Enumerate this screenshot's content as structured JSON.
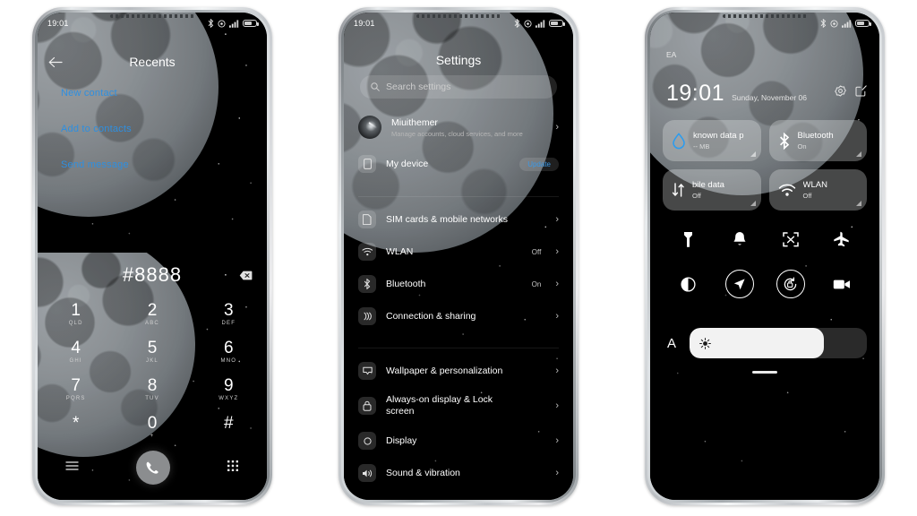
{
  "status_bar": {
    "time": "19:01",
    "icons": [
      "bluetooth-icon",
      "alarm-icon",
      "signal-icon",
      "battery-icon"
    ]
  },
  "phone1": {
    "name": "dialer-recents-screen",
    "appbar": {
      "back_icon": "back-arrow-icon",
      "title": "Recents"
    },
    "links": [
      {
        "label": "New contact"
      },
      {
        "label": "Add to contacts"
      },
      {
        "label": "Send message"
      }
    ],
    "link_color": "#2e8fe0",
    "dialpad": {
      "number": "#8888",
      "delete_icon": "backspace-icon",
      "keys": [
        {
          "digit": "1",
          "sub": "QLD"
        },
        {
          "digit": "2",
          "sub": "ABC"
        },
        {
          "digit": "3",
          "sub": "DEF"
        },
        {
          "digit": "4",
          "sub": "GHI"
        },
        {
          "digit": "5",
          "sub": "JKL"
        },
        {
          "digit": "6",
          "sub": "MNO"
        },
        {
          "digit": "7",
          "sub": "PQRS"
        },
        {
          "digit": "8",
          "sub": "TUV"
        },
        {
          "digit": "9",
          "sub": "WXYZ"
        },
        {
          "digit": "*",
          "sub": ""
        },
        {
          "digit": "0",
          "sub": "+"
        },
        {
          "digit": "#",
          "sub": ""
        }
      ]
    },
    "bottom_bar": {
      "menu_icon": "menu-icon",
      "call_icon": "call-icon",
      "keypad_icon": "keypad-grid-icon"
    }
  },
  "phone2": {
    "name": "settings-screen",
    "title": "Settings",
    "search": {
      "placeholder": "Search settings",
      "icon": "search-icon"
    },
    "account": {
      "title": "Miuithemer",
      "subtitle": "Manage accounts, cloud services, and more",
      "avatar": "account-avatar"
    },
    "my_device": {
      "label": "My device",
      "icon": "device-icon",
      "badge": "Update"
    },
    "items": [
      {
        "label": "SIM cards & mobile networks",
        "value": "",
        "icon": "sim-card-icon"
      },
      {
        "label": "WLAN",
        "value": "Off",
        "icon": "wifi-icon"
      },
      {
        "label": "Bluetooth",
        "value": "On",
        "icon": "bluetooth-icon"
      },
      {
        "label": "Connection & sharing",
        "value": "",
        "icon": "connection-sharing-icon"
      },
      {
        "label": "Wallpaper & personalization",
        "value": "",
        "icon": "wallpaper-icon"
      },
      {
        "label": "Always-on display & Lock screen",
        "value": "",
        "icon": "lock-icon"
      },
      {
        "label": "Display",
        "value": "",
        "icon": "display-icon"
      },
      {
        "label": "Sound & vibration",
        "value": "",
        "icon": "sound-icon"
      }
    ],
    "chevron": "chevron-right-icon",
    "badge_color": "#3b9ae8"
  },
  "phone3": {
    "name": "control-center-screen",
    "carrier": "EA",
    "clock": "19:01",
    "date": "Sunday, November 06",
    "header_icons": [
      "settings-gear-icon",
      "edit-icon"
    ],
    "tiles": [
      {
        "title": "known data p",
        "sub": "-- MB",
        "icon": "data-usage-icon"
      },
      {
        "title": "Bluetooth",
        "sub": "On",
        "icon": "bluetooth-icon"
      },
      {
        "title": "bile data",
        "sub": "Off",
        "icon": "mobile-data-icon"
      },
      {
        "title": "WLAN",
        "sub": "Off",
        "icon": "wifi-icon"
      }
    ],
    "toggle_icons": [
      "flashlight-icon",
      "bell-icon",
      "screenshot-icon",
      "airplane-mode-icon",
      "dark-mode-icon",
      "location-icon",
      "auto-rotate-icon",
      "screen-record-icon"
    ],
    "brightness": {
      "auto_label": "A",
      "icon": "brightness-sun-icon",
      "percent": 76
    },
    "drag_handle": "drag-handle"
  }
}
